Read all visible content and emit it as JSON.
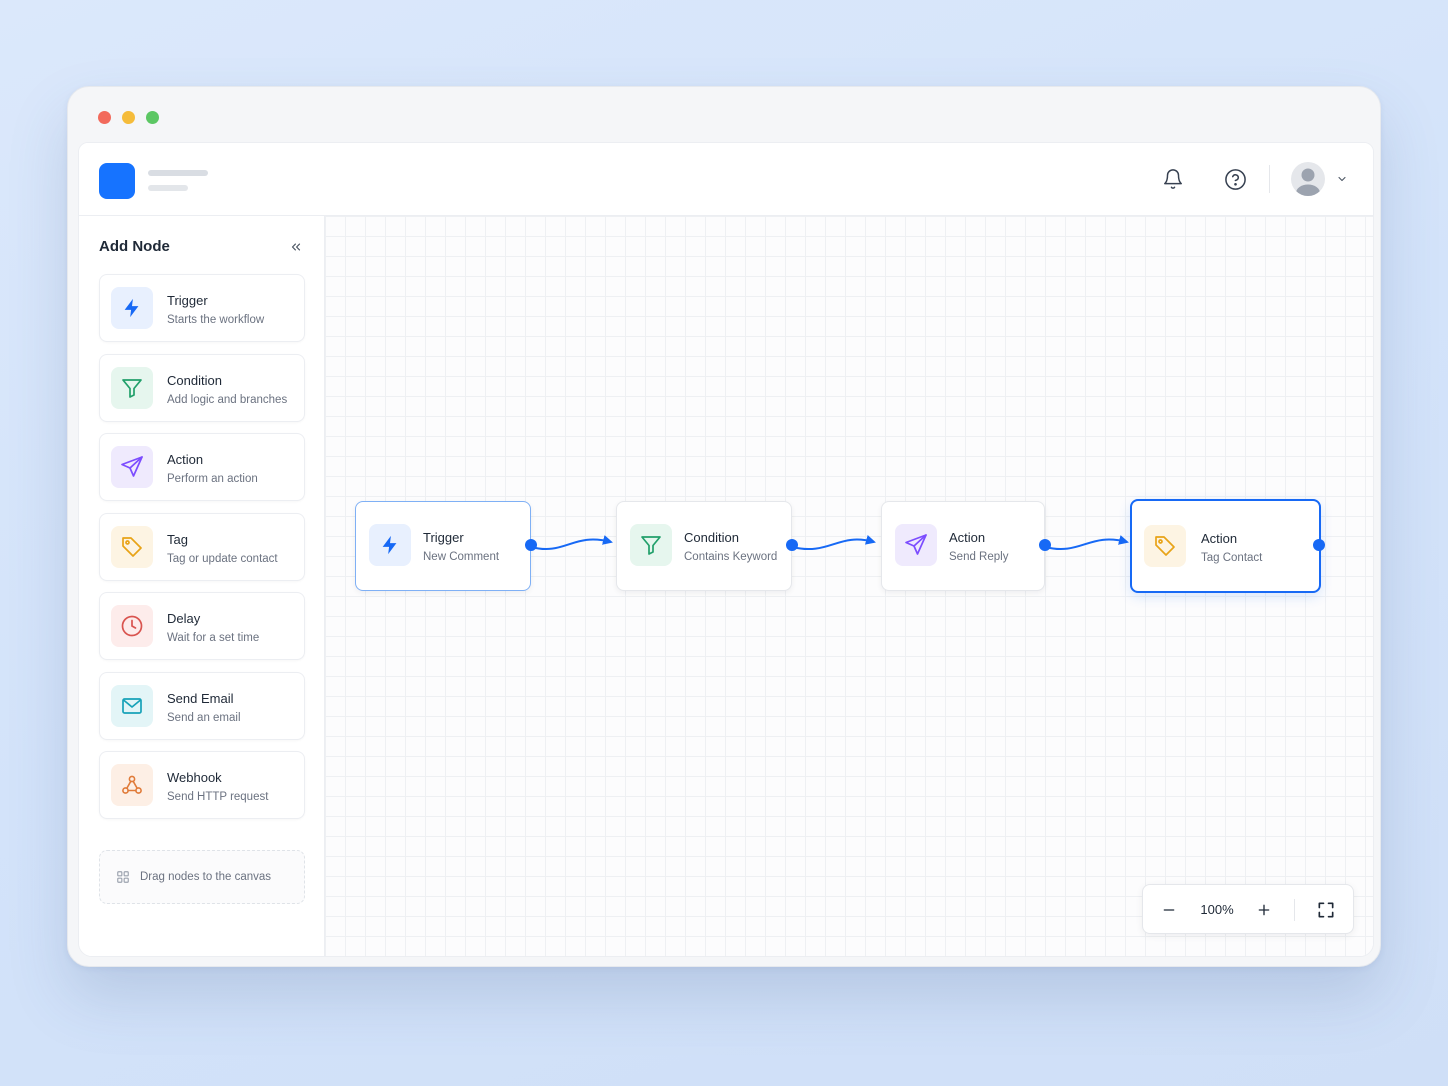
{
  "sidebar": {
    "title": "Add Node",
    "items": [
      {
        "label": "Trigger",
        "description": "Starts the workflow",
        "icon": "lightning-icon",
        "color": "#1769f5",
        "bg": "#e8f0fe"
      },
      {
        "label": "Condition",
        "description": "Add logic and branches",
        "icon": "filter-icon",
        "color": "#22a06b",
        "bg": "#e6f6ee"
      },
      {
        "label": "Action",
        "description": "Perform an action",
        "icon": "send-icon",
        "color": "#7c4dff",
        "bg": "#efeafd"
      },
      {
        "label": "Tag",
        "description": "Tag or update contact",
        "icon": "tag-icon",
        "color": "#e8a317",
        "bg": "#fdf4e3"
      },
      {
        "label": "Delay",
        "description": "Wait for a set time",
        "icon": "clock-icon",
        "color": "#d9544f",
        "bg": "#fdeceb"
      },
      {
        "label": "Send Email",
        "description": "Send an email",
        "icon": "mail-icon",
        "color": "#17a2b8",
        "bg": "#e3f5f7"
      },
      {
        "label": "Webhook",
        "description": "Send HTTP request",
        "icon": "webhook-icon",
        "color": "#e07b39",
        "bg": "#fdefe5"
      }
    ],
    "drag_hint": "Drag nodes to the canvas"
  },
  "workflow": {
    "nodes": [
      {
        "title": "Trigger",
        "subtitle": "New Comment",
        "icon": "lightning-icon"
      },
      {
        "title": "Condition",
        "subtitle": "Contains Keyword",
        "icon": "filter-icon"
      },
      {
        "title": "Action",
        "subtitle": "Send Reply",
        "icon": "send-icon"
      },
      {
        "title": "Action",
        "subtitle": "Tag Contact",
        "icon": "tag-icon",
        "selected": true
      }
    ],
    "edge_color": "#1769f5"
  },
  "zoom": {
    "value": "100%"
  },
  "colors": {
    "accent": "#1769f5",
    "logo": "#1673ff"
  }
}
